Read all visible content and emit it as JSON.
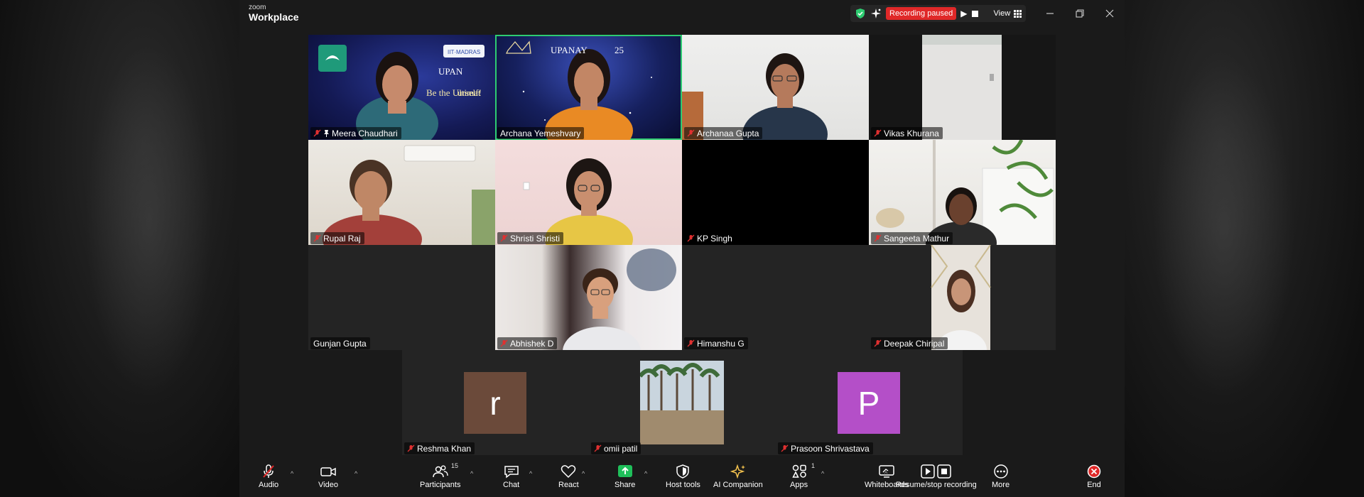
{
  "app": {
    "logo_small": "zoom",
    "logo_main": "Workplace"
  },
  "titlebar": {
    "recording_status": "Recording paused",
    "view_label": "View"
  },
  "colors": {
    "active_speaker": "#2ecc71",
    "recording": "#e02828",
    "avatar_r": "#6b4a3a",
    "avatar_p": "#b44fc8",
    "end": "#e02828"
  },
  "participants": [
    {
      "name": "Meera Chaudhari",
      "muted": true,
      "pinned": true
    },
    {
      "name": "Archana Yemeshvary",
      "muted": false,
      "active": true
    },
    {
      "name": "Archanaa Gupta",
      "muted": true
    },
    {
      "name": "Vikas Khurana",
      "muted": true
    },
    {
      "name": "Rupal Raj",
      "muted": true
    },
    {
      "name": "Shristi Shristi",
      "muted": true
    },
    {
      "name": "KP Singh",
      "muted": true
    },
    {
      "name": "Sangeeta Mathur",
      "muted": true
    },
    {
      "name": "Gunjan Gupta",
      "muted": false
    },
    {
      "name": "Abhishek D",
      "muted": true
    },
    {
      "name": "Himanshu G",
      "muted": true
    },
    {
      "name": "Deepak Chiripal",
      "muted": true
    },
    {
      "name": "Reshma Khan",
      "muted": true,
      "initial": "r"
    },
    {
      "name": "omii patil",
      "muted": true
    },
    {
      "name": "Prasoon Shrivastava",
      "muted": true,
      "initial": "P"
    }
  ],
  "slide": {
    "title_left": "UPAN",
    "subtitle_left": "Be the Ultimat",
    "subtitle_right": "urself!",
    "title_center": "UPANAY",
    "title_center_end": "25"
  },
  "toolbar": {
    "audio": "Audio",
    "video": "Video",
    "participants": "Participants",
    "participants_count": "15",
    "chat": "Chat",
    "react": "React",
    "share": "Share",
    "host_tools": "Host tools",
    "ai_companion": "AI Companion",
    "apps": "Apps",
    "apps_count": "1",
    "whiteboards": "Whiteboards",
    "recording": "Resume/stop recording",
    "more": "More",
    "end": "End"
  }
}
